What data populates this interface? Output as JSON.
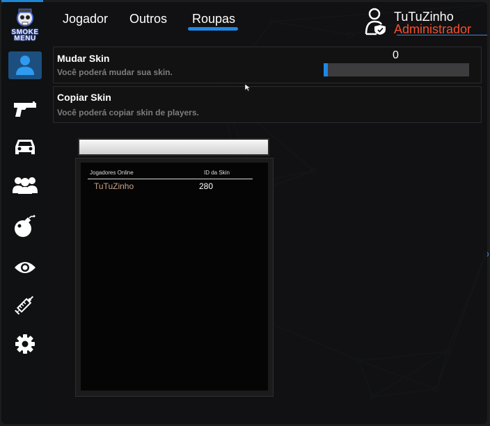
{
  "app": {
    "logo_text": "SMOKE\nMENU",
    "accent_color": "#1e88e5",
    "role_color": "#f4502a"
  },
  "sidebar": {
    "items": [
      {
        "name": "player",
        "icon": "user-icon",
        "active": true
      },
      {
        "name": "weapons",
        "icon": "pistol-icon",
        "active": false
      },
      {
        "name": "vehicles",
        "icon": "car-icon",
        "active": false
      },
      {
        "name": "players",
        "icon": "group-icon",
        "active": false
      },
      {
        "name": "explosives",
        "icon": "bomb-icon",
        "active": false
      },
      {
        "name": "visuals",
        "icon": "eye-icon",
        "active": false
      },
      {
        "name": "injector",
        "icon": "syringe-icon",
        "active": false
      },
      {
        "name": "settings",
        "icon": "gear-icon",
        "active": false
      }
    ]
  },
  "tabs": [
    {
      "label": "Jogador",
      "active": false
    },
    {
      "label": "Outros",
      "active": false
    },
    {
      "label": "Roupas",
      "active": true
    }
  ],
  "user": {
    "name": "TuTuZinho",
    "role": "Administrador"
  },
  "panels": {
    "change_skin": {
      "title": "Mudar Skin",
      "subtitle": "Você poderá mudar sua skin.",
      "value": "0",
      "fill_fraction": 0.03
    },
    "copy_skin": {
      "title": "Copiar Skin",
      "subtitle": "Você poderá copiar skin de players."
    }
  },
  "search": {
    "value": ""
  },
  "player_list": {
    "headers": [
      "Jogadores Online",
      "ID da Skin"
    ],
    "rows": [
      {
        "name": "TuTuZinho",
        "skin_id": "280"
      }
    ]
  }
}
